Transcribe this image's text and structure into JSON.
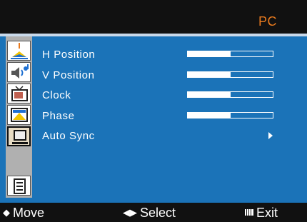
{
  "header": {
    "title": "PC"
  },
  "sidebar": {
    "icons": [
      {
        "name": "color-adjust-icon"
      },
      {
        "name": "audio-icon"
      },
      {
        "name": "tv-icon"
      },
      {
        "name": "picture-icon"
      },
      {
        "name": "pc-settings-icon"
      },
      {
        "name": "info-icon"
      }
    ],
    "selected_index": 4
  },
  "menu": {
    "items": [
      {
        "label": "H Position",
        "level": 0.5
      },
      {
        "label": "V Position",
        "level": 0.5
      },
      {
        "label": "Clock",
        "level": 0.5
      },
      {
        "label": "Phase",
        "level": 0.5
      },
      {
        "label": "Auto Sync",
        "action": "submenu-arrow"
      }
    ]
  },
  "footer": {
    "move_label": "Move",
    "select_label": "Select",
    "exit_label": "Exit",
    "move_glyph": "◆",
    "select_glyph": "◀▶"
  },
  "colors": {
    "title": "#e87a1e",
    "panel": "#1b73b8",
    "bars": "#111111"
  }
}
